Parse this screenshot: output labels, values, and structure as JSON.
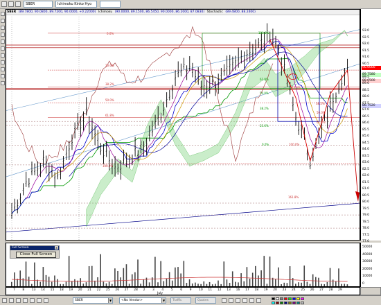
{
  "toolbar": {
    "symbol_combo": "SBER",
    "indicator_combo": "Ichimoku Kinko Hyo",
    "extra_combo": ""
  },
  "header": {
    "symbol": "SBER",
    "ohlc": "(89.7800, 90.0800, 89.7200, 90.0000, +0.22000)",
    "indicator_name": "Ichimoku",
    "ichimoku_values": "(90.0000, 89.1500, 86.5450, 90.0000, 86.2000, 87.0830)",
    "indicator2_name": "Stochastic",
    "indicator2_values": "(89.4800, 88.2400)"
  },
  "fibonacci_levels": {
    "upper": [
      {
        "text": "0.0%"
      },
      {
        "text": "23.6%"
      },
      {
        "text": "38.2%"
      },
      {
        "text": "50.0%"
      },
      {
        "text": "61.8%"
      },
      {
        "text": "100.0%"
      }
    ],
    "right": [
      {
        "text": "100.0%"
      },
      {
        "text": "61.8%"
      },
      {
        "text": "50.0%"
      },
      {
        "text": "38.2%"
      },
      {
        "text": "23.6%"
      },
      {
        "text": "0.0%"
      },
      {
        "text": "100.0%"
      },
      {
        "text": "161.8%"
      }
    ],
    "right_mid": [
      {
        "text": "23.6%"
      },
      {
        "text": "38.2%"
      },
      {
        "text": "50.0%"
      },
      {
        "text": "61.8%"
      }
    ]
  },
  "price_axis": {
    "labels": [
      "93.0",
      "92.5",
      "92.0",
      "91.5",
      "91.0",
      "90.5",
      "89.5",
      "89.0",
      "88.5",
      "88.0",
      "87.5",
      "87.0",
      "86.5",
      "86.0",
      "85.5",
      "85.0",
      "84.5",
      "84.0",
      "83.5",
      "83.0",
      "82.5",
      "82.0",
      "81.5",
      "81.0",
      "80.5",
      "80.0",
      "79.5",
      "79.0",
      "78.5",
      "78.0",
      "77.5",
      "77.0",
      "76.5"
    ],
    "current_price": "90.0000",
    "current_price_color": "#ffffff",
    "current_price_bg": "#ff0000",
    "level_a": "88.6500",
    "level_b": "89.7580",
    "level_c": "86.7520"
  },
  "volume_axis": {
    "labels": [
      "50000",
      "40000",
      "30000",
      "20000",
      "10000",
      "0"
    ]
  },
  "full_screen_panel": {
    "title": "Full Screen",
    "close_x": "x",
    "button_label": "Close Full Screen"
  },
  "time_axis": {
    "days": [
      "7",
      "8",
      "13",
      "14",
      "15",
      "18",
      "19",
      "20",
      "21",
      "22",
      "25",
      "26",
      "27",
      "28",
      "2",
      "3",
      "4",
      "5",
      "6",
      "9",
      "10",
      "11",
      "12",
      "13",
      "16",
      "17",
      "18",
      "19",
      "20",
      "23",
      "24",
      "25",
      "26",
      "27",
      "28",
      "29"
    ],
    "month": "July"
  },
  "statusbar": {
    "symbol_field": "SBER",
    "vendor_field": "<No Vendor>",
    "grey_field": "Traffic",
    "grey_field2": "Quotes"
  },
  "colors": {
    "price_bars": "#000000",
    "ichimoku_cloud": "#66cc66",
    "ichimoku_cloud_down": "#ff9999",
    "tenkan": "#000099",
    "kijun": "#006600",
    "chikou": "#993333",
    "channel": "#6699cc",
    "fib_lines": "#cc3333",
    "forecast_arrow": "#cc0000"
  }
}
